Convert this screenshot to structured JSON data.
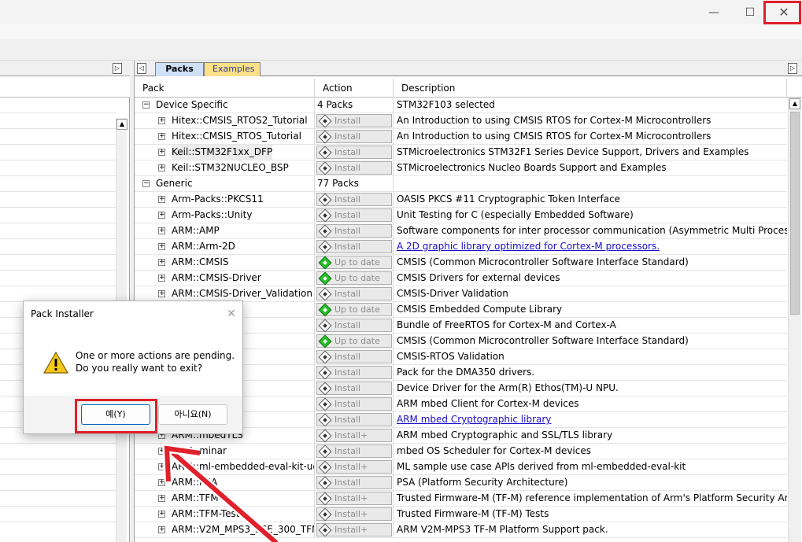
{
  "window": {
    "minimize_glyph": "—",
    "maximize_glyph": "☐",
    "close_glyph": "✕"
  },
  "right_panel": {
    "tabs": [
      {
        "label": "Packs",
        "active": true
      },
      {
        "label": "Examples",
        "active": false
      }
    ],
    "columns": {
      "pack": "Pack",
      "action": "Action",
      "description": "Description"
    },
    "rows": [
      {
        "level": 0,
        "expander": "−",
        "name": "Device Specific",
        "action_type": "text",
        "action": "4 Packs",
        "description": "STM32F103 selected",
        "link": false
      },
      {
        "level": 1,
        "expander": "+",
        "name": "Hitex::CMSIS_RTOS2_Tutorial",
        "action_type": "button",
        "action": "Install",
        "icon": "install-icon",
        "description": "An Introduction to using CMSIS RTOS for Cortex-M Microcontrollers",
        "link": false
      },
      {
        "level": 1,
        "expander": "+",
        "name": "Hitex::CMSIS_RTOS_Tutorial",
        "action_type": "button",
        "action": "Install",
        "icon": "install-icon",
        "description": "An Introduction to using CMSIS RTOS for Cortex-M Microcontrollers",
        "link": false
      },
      {
        "level": 1,
        "expander": "+",
        "name": "Keil::STM32F1xx_DFP",
        "action_type": "button",
        "action": "Install",
        "icon": "install-icon",
        "description": "STMicroelectronics STM32F1 Series Device Support, Drivers and Examples",
        "link": false,
        "selected": true
      },
      {
        "level": 1,
        "expander": "+",
        "name": "Keil::STM32NUCLEO_BSP",
        "action_type": "button",
        "action": "Install",
        "icon": "install-icon",
        "description": "STMicroelectronics Nucleo Boards Support and Examples",
        "link": false
      },
      {
        "level": 0,
        "expander": "−",
        "name": "Generic",
        "action_type": "text",
        "action": "77 Packs",
        "description": "",
        "link": false
      },
      {
        "level": 1,
        "expander": "+",
        "name": "Arm-Packs::PKCS11",
        "action_type": "button",
        "action": "Install",
        "icon": "install-icon",
        "description": "OASIS PKCS #11 Cryptographic Token Interface",
        "link": false
      },
      {
        "level": 1,
        "expander": "+",
        "name": "Arm-Packs::Unity",
        "action_type": "button",
        "action": "Install",
        "icon": "install-icon",
        "description": "Unit Testing for C (especially Embedded Software)",
        "link": false
      },
      {
        "level": 1,
        "expander": "+",
        "name": "ARM::AMP",
        "action_type": "button",
        "action": "Install",
        "icon": "install-icon",
        "description": "Software components for inter processor communication (Asymmetric Multi Processing AMP)",
        "link": false
      },
      {
        "level": 1,
        "expander": "+",
        "name": "ARM::Arm-2D",
        "action_type": "button",
        "action": "Install",
        "icon": "install-icon",
        "description": "A 2D graphic library optimized for Cortex-M processors.",
        "link": true
      },
      {
        "level": 1,
        "expander": "+",
        "name": "ARM::CMSIS",
        "action_type": "button",
        "action": "Up to date",
        "icon": "up-to-date-icon",
        "description": "CMSIS (Common Microcontroller Software Interface Standard)",
        "link": false
      },
      {
        "level": 1,
        "expander": "+",
        "name": "ARM::CMSIS-Driver",
        "action_type": "button",
        "action": "Up to date",
        "icon": "up-to-date-icon",
        "description": "CMSIS Drivers for external devices",
        "link": false
      },
      {
        "level": 1,
        "expander": "+",
        "name": "ARM::CMSIS-Driver_Validation",
        "action_type": "button",
        "action": "Install",
        "icon": "install-icon",
        "description": "CMSIS-Driver Validation",
        "link": false
      },
      {
        "level": 1,
        "expander": "+",
        "name": "",
        "action_type": "button",
        "action": "Up to date",
        "icon": "up-to-date-icon",
        "description": "CMSIS Embedded Compute Library",
        "link": false
      },
      {
        "level": 1,
        "expander": "+",
        "name": "eRTOS",
        "action_type": "button",
        "action": "Install",
        "icon": "install-icon",
        "description": "Bundle of FreeRTOS for Cortex-M and Cortex-A",
        "link": false
      },
      {
        "level": 1,
        "expander": "+",
        "name": "",
        "action_type": "button",
        "action": "Up to date",
        "icon": "up-to-date-icon",
        "description": "CMSIS (Common Microcontroller Software Interface Standard)",
        "link": false
      },
      {
        "level": 1,
        "expander": "+",
        "name": "S_Validation",
        "action_type": "button",
        "action": "Install",
        "icon": "install-icon",
        "description": "CMSIS-RTOS Validation",
        "link": false
      },
      {
        "level": 1,
        "expander": "+",
        "name": "",
        "action_type": "button",
        "action": "Install",
        "icon": "install-icon",
        "description": "Pack for the DMA350 drivers.",
        "link": false
      },
      {
        "level": 1,
        "expander": "+",
        "name": "re-driver",
        "action_type": "button",
        "action": "Install",
        "icon": "install-icon",
        "description": "Device Driver for the Arm(R) Ethos(TM)-U NPU.",
        "link": false
      },
      {
        "level": 1,
        "expander": "+",
        "name": "t",
        "action_type": "button",
        "action": "Install",
        "icon": "install-icon",
        "description": "ARM mbed Client for Cortex-M devices",
        "link": false
      },
      {
        "level": 1,
        "expander": "+",
        "name": "to",
        "action_type": "button",
        "action": "Install",
        "icon": "install-icon",
        "description": "ARM mbed Cryptographic library",
        "link": true
      },
      {
        "level": 1,
        "expander": "+",
        "name": "ARM::mbedTLS",
        "action_type": "button",
        "action": "Install+",
        "icon": "install-icon",
        "description": "ARM mbed Cryptographic and SSL/TLS library",
        "link": false
      },
      {
        "level": 1,
        "expander": "+",
        "name": "ARM::minar",
        "action_type": "button",
        "action": "Install",
        "icon": "install-icon",
        "description": "mbed OS Scheduler for Cortex-M devices",
        "link": false
      },
      {
        "level": 1,
        "expander": "+",
        "name": "ARM::ml-embedded-eval-kit-uc...",
        "action_type": "button",
        "action": "Install+",
        "icon": "install-icon",
        "description": "ML sample use case APIs derived from ml-embedded-eval-kit",
        "link": false
      },
      {
        "level": 1,
        "expander": "+",
        "name": "ARM::PSA",
        "action_type": "button",
        "action": "Install",
        "icon": "install-icon",
        "description": "PSA (Platform Security Architecture)",
        "link": false
      },
      {
        "level": 1,
        "expander": "+",
        "name": "ARM::TFM",
        "action_type": "button",
        "action": "Install+",
        "icon": "install-icon",
        "description": "Trusted Firmware-M (TF-M) reference implementation of Arm's Platform Security Architecture",
        "link": false
      },
      {
        "level": 1,
        "expander": "+",
        "name": "ARM::TFM-Test",
        "action_type": "button",
        "action": "Install+",
        "icon": "install-icon",
        "description": "Trusted Firmware-M (TF-M) Tests",
        "link": false
      },
      {
        "level": 1,
        "expander": "+",
        "name": "ARM::V2M_MPS3_SSE_300_TFM-...",
        "action_type": "button",
        "action": "Install+",
        "icon": "install-icon",
        "description": "ARM V2M-MPS3 TF-M Platform Support pack.",
        "link": false
      }
    ]
  },
  "dialog": {
    "title": "Pack Installer",
    "close_glyph": "✕",
    "message_line1": "One or more actions are pending.",
    "message_line2": "Do you really want to exit?",
    "yes_label": "예(Y)",
    "no_label": "아니요(N)",
    "icon": "warning-icon"
  },
  "colors": {
    "highlight": "#e0202a",
    "link": "#1a0dcc",
    "packs_tab": "#cfe0f7",
    "examples_tab": "#fbe08a",
    "up_to_date_green": "#26c126"
  }
}
